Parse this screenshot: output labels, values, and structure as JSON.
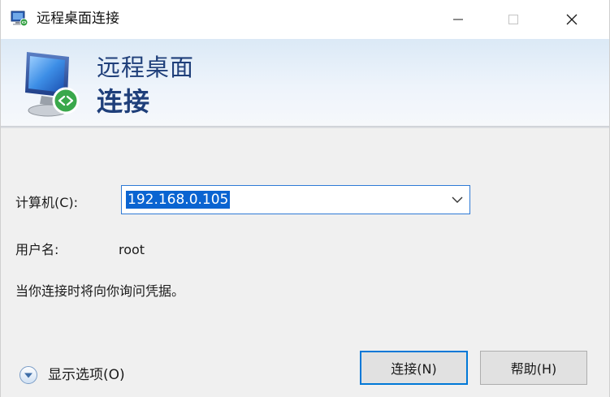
{
  "window": {
    "title": "远程桌面连接"
  },
  "banner": {
    "line1": "远程桌面",
    "line2": "连接"
  },
  "form": {
    "computer_label": "计算机(C):",
    "computer_value": "192.168.0.105",
    "user_label": "用户名:",
    "user_value": "root",
    "note": "当你连接时将向你询问凭据。"
  },
  "footer": {
    "options_label": "显示选项(O)",
    "connect_label": "连接(N)",
    "help_label": "帮助(H)"
  },
  "colors": {
    "accent": "#0078d7",
    "selection": "#0a64d1",
    "banner_text": "#1f3f7a"
  }
}
